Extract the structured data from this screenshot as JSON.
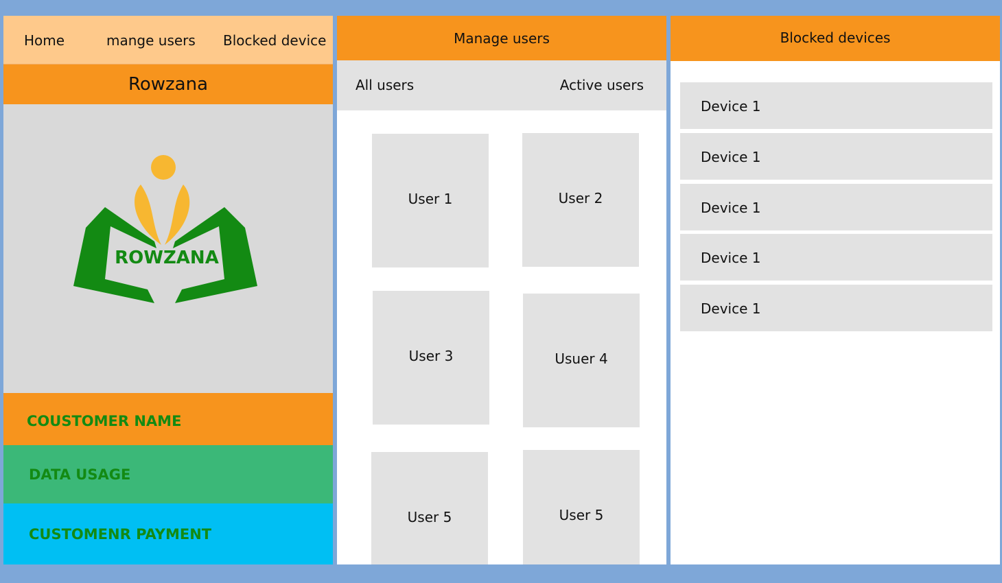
{
  "nav": {
    "home": "Home",
    "manage_users": "mange users",
    "blocked_device": "Blocked device"
  },
  "brand": {
    "title": "Rowzana",
    "logo_text": "ROWZANA"
  },
  "info": {
    "customer_name": "COUSTOMER NAME",
    "data_usage": "DATA USAGE",
    "customer_payment": "CUSTOMENR PAYMENT"
  },
  "manage": {
    "title": "Manage users",
    "tabs": {
      "all": "All users",
      "active": "Active users"
    },
    "users": [
      "User 1",
      "User 2",
      "User 3",
      "Usuer 4",
      "User 5",
      "User 5"
    ]
  },
  "blocked": {
    "title": "Blocked devices",
    "devices": [
      "Device 1",
      "Device 1",
      "Device 1",
      "Device 1",
      "Device 1"
    ]
  },
  "colors": {
    "background": "#7ea7d8",
    "accent_orange": "#f7941d",
    "light_orange": "#fec98b",
    "green": "#3bb878",
    "cyan": "#00bff3",
    "logo_green": "#138a13",
    "logo_yellow": "#f7b731"
  }
}
